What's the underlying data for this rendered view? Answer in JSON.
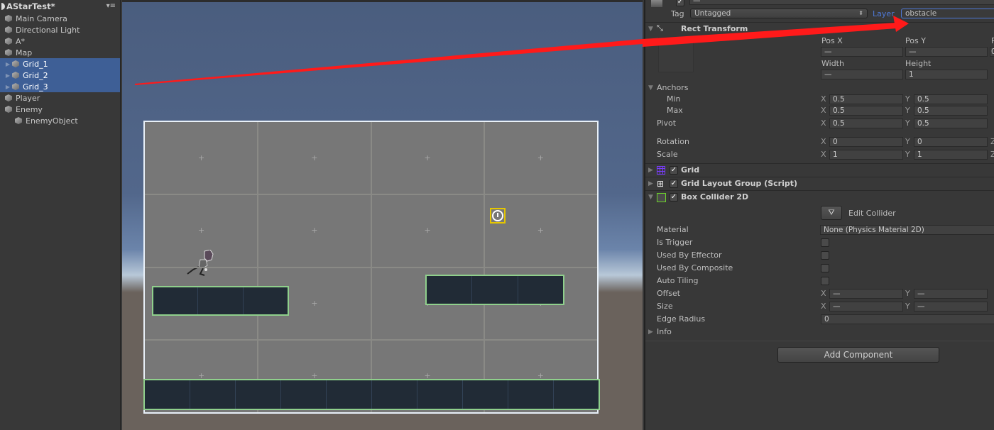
{
  "hierarchy": {
    "scene_name": "AStarTest*",
    "menu_icon": "menu-icon",
    "items": [
      {
        "label": "Main Camera",
        "indent": 0,
        "selected": false,
        "expandable": false
      },
      {
        "label": "Directional Light",
        "indent": 0,
        "selected": false,
        "expandable": false
      },
      {
        "label": "A*",
        "indent": 0,
        "selected": false,
        "expandable": false
      },
      {
        "label": "Map",
        "indent": 0,
        "selected": false,
        "expandable": false
      },
      {
        "label": "Grid_1",
        "indent": 1,
        "selected": true,
        "expandable": true
      },
      {
        "label": "Grid_2",
        "indent": 1,
        "selected": true,
        "expandable": true
      },
      {
        "label": "Grid_3",
        "indent": 1,
        "selected": true,
        "expandable": true
      },
      {
        "label": "Player",
        "indent": 0,
        "selected": false,
        "expandable": false
      },
      {
        "label": "Enemy",
        "indent": 0,
        "selected": false,
        "expandable": false
      },
      {
        "label": "EnemyObject",
        "indent": 1,
        "selected": false,
        "expandable": false
      }
    ]
  },
  "scene": {
    "grid_columns": 4,
    "grid_rows": 4,
    "platforms": [
      {
        "name": "left-platform",
        "tiles": 3
      },
      {
        "name": "right-platform",
        "tiles": 3
      },
      {
        "name": "ground-platform",
        "tiles": 10
      }
    ]
  },
  "inspector": {
    "tag_label": "Tag",
    "tag_value": "Untagged",
    "layer_label": "Layer",
    "layer_value": "obstacle",
    "rect_transform": {
      "title": "Rect Transform",
      "pos_x_label": "Pos X",
      "pos_y_label": "Pos Y",
      "pos_z_label": "P",
      "pos_x": "—",
      "pos_y": "—",
      "pos_z": "0",
      "width_label": "Width",
      "height_label": "Height",
      "width": "—",
      "height": "1",
      "anchors_label": "Anchors",
      "min_label": "Min",
      "max_label": "Max",
      "min_x": "0.5",
      "min_y": "0.5",
      "max_x": "0.5",
      "max_y": "0.5",
      "pivot_label": "Pivot",
      "pivot_x": "0.5",
      "pivot_y": "0.5",
      "rotation_label": "Rotation",
      "rotation_x": "0",
      "rotation_y": "0",
      "scale_label": "Scale",
      "scale_x": "1",
      "scale_y": "1",
      "x": "X",
      "y": "Y",
      "z": "Z"
    },
    "components": {
      "grid": "Grid",
      "grid_layout": "Grid Layout Group (Script)",
      "box_collider": "Box Collider 2D"
    },
    "box_collider": {
      "edit_collider": "Edit Collider",
      "material_label": "Material",
      "material_value": "None (Physics Material 2D)",
      "is_trigger_label": "Is Trigger",
      "used_by_effector_label": "Used By Effector",
      "used_by_composite_label": "Used By Composite",
      "auto_tiling_label": "Auto Tiling",
      "offset_label": "Offset",
      "offset_x": "—",
      "offset_y": "—",
      "size_label": "Size",
      "size_x": "—",
      "size_y": "—",
      "edge_radius_label": "Edge Radius",
      "edge_radius": "0",
      "info_label": "Info"
    },
    "add_component": "Add Component"
  },
  "colors": {
    "selection": "#3e5f96",
    "layer_accent": "#4f79d6",
    "annotation_arrow": "#ff1a1a",
    "collider_outline": "#8fd08c",
    "target_outline": "#e5c600"
  }
}
